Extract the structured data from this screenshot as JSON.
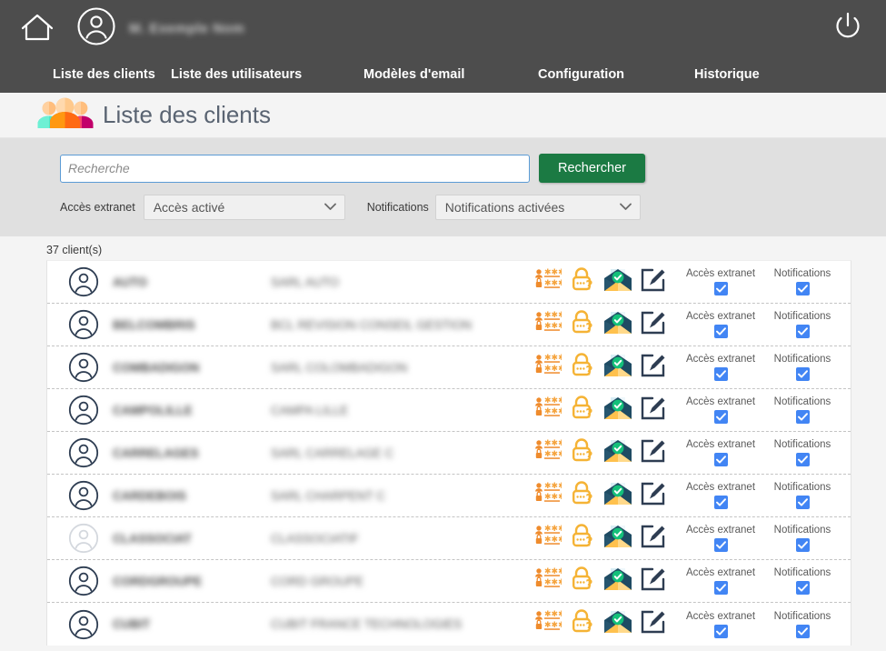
{
  "header": {
    "home_icon": "home-icon",
    "user_icon": "user-avatar-icon",
    "username": "M. Exemple Nom",
    "power_icon": "power-icon"
  },
  "nav": {
    "items": [
      {
        "label": "Liste des clients"
      },
      {
        "label": "Liste des utilisateurs"
      },
      {
        "label": "Modèles d'email"
      },
      {
        "label": "Configuration"
      },
      {
        "label": "Historique"
      }
    ]
  },
  "page": {
    "title": "Liste des clients",
    "title_icon": "people-group-icon"
  },
  "search": {
    "placeholder": "Recherche",
    "value": "",
    "button_label": "Rechercher",
    "access_filter_label": "Accès extranet",
    "access_filter_value": "Accès activé",
    "notifications_filter_label": "Notifications",
    "notifications_filter_value": "Notifications activées"
  },
  "table": {
    "count_label": "37 client(s)",
    "action_icons": [
      "credentials-icon",
      "reset-password-icon",
      "send-email-icon",
      "edit-icon"
    ],
    "checkbox_labels": {
      "access": "Accès extranet",
      "notifications": "Notifications"
    },
    "rows": [
      {
        "code": "AUTO",
        "name": "SARL AUTO",
        "access": true,
        "notifications": true,
        "enabled": true
      },
      {
        "code": "BELCOMBRIS",
        "name": "BCL REVISION CONSEIL GESTION",
        "access": true,
        "notifications": true,
        "enabled": true
      },
      {
        "code": "COMBADIGON",
        "name": "SARL COLOMBADIGON",
        "access": true,
        "notifications": true,
        "enabled": true
      },
      {
        "code": "CAMPOLILLE",
        "name": "CAMPA LILLE",
        "access": true,
        "notifications": true,
        "enabled": true
      },
      {
        "code": "CARRELAGES",
        "name": "SARL CARRELAGE C",
        "access": true,
        "notifications": true,
        "enabled": true
      },
      {
        "code": "CARDEBOIS",
        "name": "SARL CHARPENT C",
        "access": true,
        "notifications": true,
        "enabled": true
      },
      {
        "code": "CLASSOCIAT",
        "name": "CLASSOCIATIF",
        "access": true,
        "notifications": true,
        "enabled": false
      },
      {
        "code": "CORDGROUPE",
        "name": "CORD GROUPE",
        "access": true,
        "notifications": true,
        "enabled": true
      },
      {
        "code": "CUBIT",
        "name": "CUBIT FRANCE TECHNOLOGIES",
        "access": true,
        "notifications": true,
        "enabled": true
      }
    ]
  },
  "colors": {
    "header_bg": "#4d4d4d",
    "search_panel_bg": "#e0e0e0",
    "page_bg": "#f4f4f4",
    "button_green": "#1b7a43",
    "checkbox_blue": "#4285f4",
    "title_text": "#5a6472",
    "focus_border": "#5b9bd5"
  }
}
